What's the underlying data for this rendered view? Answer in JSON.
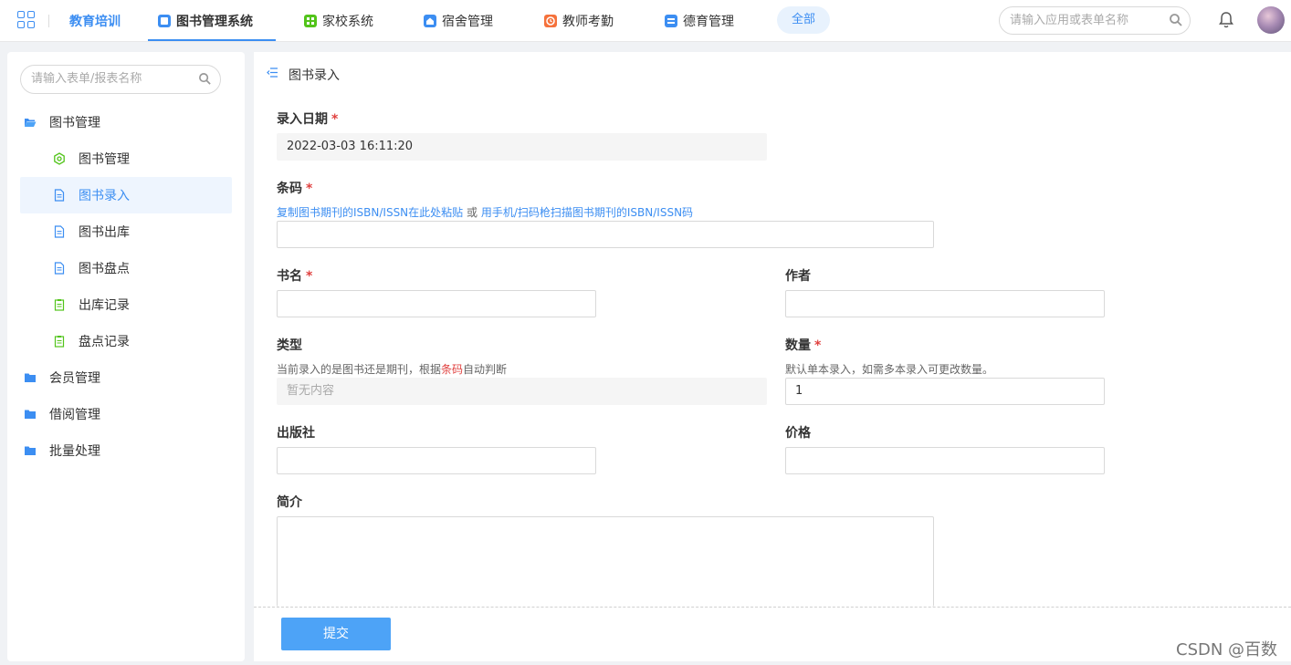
{
  "topbar": {
    "brand": "教育培训",
    "nav": [
      {
        "label": "图书管理系统",
        "color": "#3c8ef2",
        "icon": "book-app-icon"
      },
      {
        "label": "家校系统",
        "color": "#52c41a",
        "icon": "grid-app-icon"
      },
      {
        "label": "宿舍管理",
        "color": "#3c8ef2",
        "icon": "home-app-icon"
      },
      {
        "label": "教师考勤",
        "color": "#f5713b",
        "icon": "clock-app-icon"
      },
      {
        "label": "德育管理",
        "color": "#3c8ef2",
        "icon": "card-app-icon"
      }
    ],
    "all_label": "全部",
    "search_placeholder": "请输入应用或表单名称"
  },
  "sidebar": {
    "search_placeholder": "请输入表单/报表名称",
    "items": [
      {
        "label": "图书管理",
        "type": "group",
        "icon": "folder-open-icon"
      },
      {
        "label": "图书管理",
        "type": "sub",
        "icon": "gear-icon"
      },
      {
        "label": "图书录入",
        "type": "sub",
        "icon": "document-icon",
        "selected": true
      },
      {
        "label": "图书出库",
        "type": "sub",
        "icon": "document-icon"
      },
      {
        "label": "图书盘点",
        "type": "sub",
        "icon": "document-icon"
      },
      {
        "label": "出库记录",
        "type": "sub",
        "icon": "clipboard-icon"
      },
      {
        "label": "盘点记录",
        "type": "sub",
        "icon": "clipboard-icon"
      },
      {
        "label": "会员管理",
        "type": "group",
        "icon": "folder-icon"
      },
      {
        "label": "借阅管理",
        "type": "group",
        "icon": "folder-icon"
      },
      {
        "label": "批量处理",
        "type": "group",
        "icon": "folder-icon"
      }
    ]
  },
  "form": {
    "title": "图书录入",
    "date_label": "录入日期",
    "date_value": "2022-03-03 16:11:20",
    "barcode_label": "条码",
    "barcode_hint_a": "复制图书期刊的ISBN/ISSN在此处粘贴",
    "barcode_hint_or": "或",
    "barcode_hint_b": "用手机/扫码枪扫描图书期刊的ISBN/ISSN码",
    "title_label": "书名",
    "author_label": "作者",
    "type_label": "类型",
    "type_hint_a": "当前录入的是图书还是期刊，根据",
    "type_hint_link": "条码",
    "type_hint_b": "自动判断",
    "type_placeholder": "暂无内容",
    "qty_label": "数量",
    "qty_hint": "默认单本录入，如需多本录入可更改数量。",
    "qty_value": "1",
    "publisher_label": "出版社",
    "price_label": "价格",
    "intro_label": "简介",
    "submit_label": "提交"
  },
  "watermark": "CSDN @百数"
}
